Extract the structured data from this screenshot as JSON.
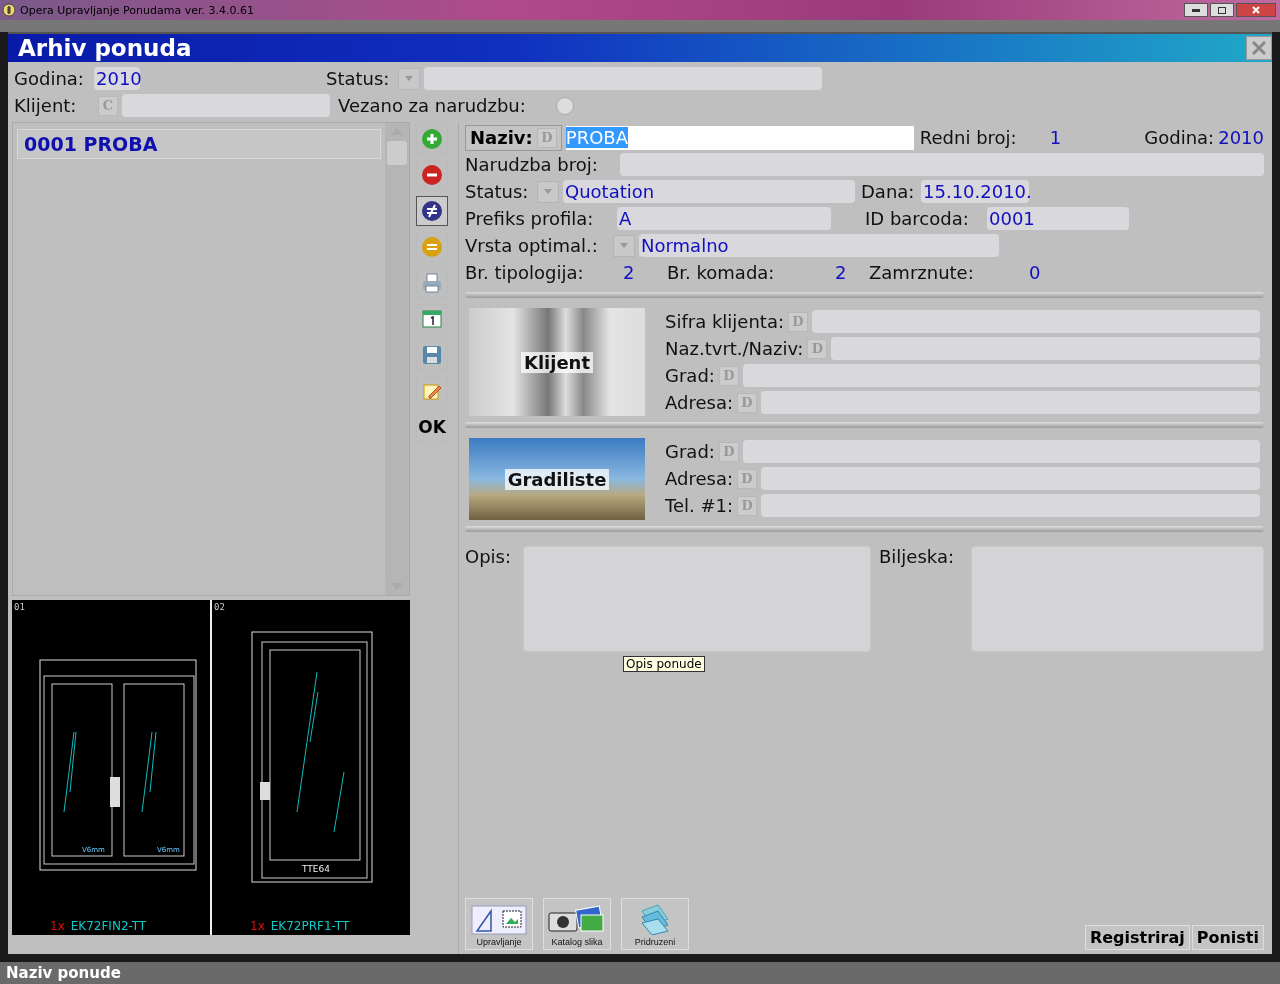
{
  "app_title": "Opera Upravljanje Ponudama ver. 3.4.0.61",
  "dialog": {
    "title": "Arhiv ponuda"
  },
  "filter": {
    "godina_label": "Godina:",
    "godina": "2010",
    "status_label": "Status:",
    "klijent_label": "Klijent:",
    "klijent_button": "C",
    "vezano_label": "Vezano za narudzbu:",
    "vezano_checked": false
  },
  "offers": [
    {
      "label": "0001 PROBA",
      "selected": true
    }
  ],
  "toolbar": [
    {
      "kind": "add",
      "pressed": false
    },
    {
      "kind": "remove",
      "pressed": false
    },
    {
      "kind": "not-equal",
      "pressed": true
    },
    {
      "kind": "equal",
      "pressed": false
    },
    {
      "kind": "print",
      "pressed": false
    },
    {
      "kind": "calendar",
      "pressed": false
    },
    {
      "kind": "save",
      "pressed": false
    },
    {
      "kind": "edit",
      "pressed": false
    },
    {
      "kind": "text",
      "label": "OK",
      "pressed": false
    }
  ],
  "previews": [
    {
      "number": "01",
      "count": "1x",
      "code": "EK72FIN2-TT",
      "kind": "double",
      "labels": [
        "V6mm",
        "V6mm"
      ]
    },
    {
      "number": "02",
      "count": "1x",
      "code": "EK72PRF1-TT",
      "kind": "single",
      "labels": [
        "TTE64"
      ]
    }
  ],
  "details": {
    "naziv_label": "Naziv:",
    "naziv_button": "D",
    "naziv": "PROBA",
    "naziv_selected": true,
    "redni_label": "Redni broj:",
    "redni": "1",
    "godina_label": "Godina:",
    "godina": "2010",
    "narudzba_label": "Narudzba broj:",
    "status_label": "Status:",
    "status": "Quotation",
    "dana_label": "Dana:",
    "dana": "15.10.2010.",
    "prefiks_label": "Prefiks profila:",
    "prefiks": "A",
    "barcode_label": "ID barcoda:",
    "barcode": "0001",
    "vrsta_label": "Vrsta optimal.:",
    "vrsta": "Normalno",
    "tipologija_label": "Br. tipologija:",
    "tipologija": "2",
    "komada_label": "Br. komada:",
    "komada": "2",
    "zamrznute_label": "Zamrznute:",
    "zamrznute": "0"
  },
  "client": {
    "image_label": "Klijent",
    "fields": [
      {
        "label": "Sifra klijenta:",
        "button": "D"
      },
      {
        "label": "Naz.tvrt./Naziv:",
        "button": "D"
      },
      {
        "label": "Grad:",
        "button": "D"
      },
      {
        "label": "Adresa:",
        "button": "D"
      }
    ]
  },
  "site": {
    "image_label": "Gradiliste",
    "fields": [
      {
        "label": "Grad:",
        "button": "D"
      },
      {
        "label": "Adresa:",
        "button": "D"
      },
      {
        "label": "Tel. #1:",
        "button": "D"
      }
    ]
  },
  "notes": {
    "opis_label": "Opis:",
    "biljeska_label": "Biljeska:",
    "tooltip": "Opis ponude"
  },
  "bottom_buttons": [
    {
      "kind": "manage",
      "label": "Upravljanje"
    },
    {
      "kind": "catalog",
      "label": "Katalog slika"
    },
    {
      "kind": "attached",
      "label": "Pridruzeni"
    }
  ],
  "actions": [
    "Registriraj",
    "Ponisti"
  ],
  "status_bar": "Naziv ponude"
}
